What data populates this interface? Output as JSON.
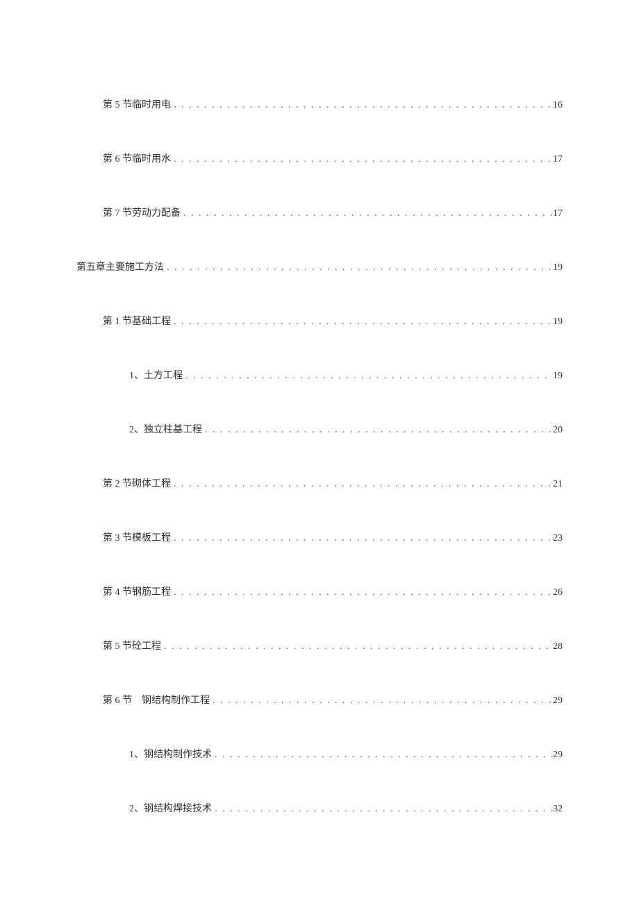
{
  "toc": [
    {
      "level": 1,
      "label": "第 5 节临时用电",
      "page": "16"
    },
    {
      "level": 1,
      "label": "第 6 节临时用水",
      "page": "17"
    },
    {
      "level": 1,
      "label": "第 7 节劳动力配备",
      "page": "17"
    },
    {
      "level": 0,
      "label": "第五章主要施工方法",
      "page": "19"
    },
    {
      "level": 1,
      "label": "第 1 节基础工程",
      "page": "19"
    },
    {
      "level": 2,
      "label": "1、土方工程",
      "page": "19"
    },
    {
      "level": 2,
      "label": "2、独立柱基工程",
      "page": "20"
    },
    {
      "level": 1,
      "label": "第 2 节砌体工程",
      "page": "21"
    },
    {
      "level": 1,
      "label": "第 3 节模板工程",
      "page": "23"
    },
    {
      "level": 1,
      "label": "第 4 节钢筋工程",
      "page": "26"
    },
    {
      "level": 1,
      "label": "第 5 节砼工程",
      "page": "28"
    },
    {
      "level": 1,
      "label": "第 6 节　钢结构制作工程",
      "page": "29"
    },
    {
      "level": 2,
      "label": "1、钢结构制作技术",
      "page": "29"
    },
    {
      "level": 2,
      "label": "2、钢结构焊接技术",
      "page": "32"
    }
  ]
}
